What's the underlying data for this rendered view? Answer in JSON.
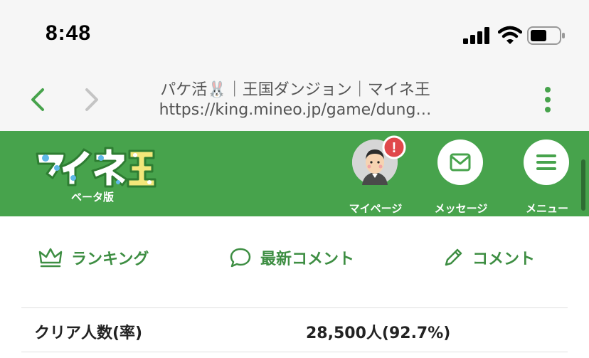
{
  "status_bar": {
    "time": "8:48",
    "icons": [
      "signal-icon",
      "wifi-icon",
      "battery-icon"
    ]
  },
  "browser": {
    "title": "パケ活🐰｜王国ダンジョン｜マイネ王",
    "url": "https://king.mineo.jp/game/dung…",
    "icons": [
      "back-icon",
      "forward-icon",
      "more-vertical-icon"
    ]
  },
  "header": {
    "logo_text": "マイネ王",
    "logo_sub": "ベータ版",
    "buttons": [
      {
        "label": "マイページ",
        "icon": "avatar-icon",
        "badge": "!"
      },
      {
        "label": "メッセージ",
        "icon": "mail-icon"
      },
      {
        "label": "メニュー",
        "icon": "hamburger-menu-icon"
      }
    ]
  },
  "tabs": [
    {
      "label": "ランキング",
      "icon": "crown-icon"
    },
    {
      "label": "最新コメント",
      "icon": "speech-bubble-icon"
    },
    {
      "label": "コメント",
      "icon": "pencil-icon"
    }
  ],
  "stats": {
    "label": "クリア人数(率)",
    "value": "28,500人(92.7%)"
  },
  "colors": {
    "brand_green": "#47a34c",
    "tab_green": "#3e8e43",
    "badge_red": "#e0484b",
    "browser_bg": "#f6f6f6"
  }
}
